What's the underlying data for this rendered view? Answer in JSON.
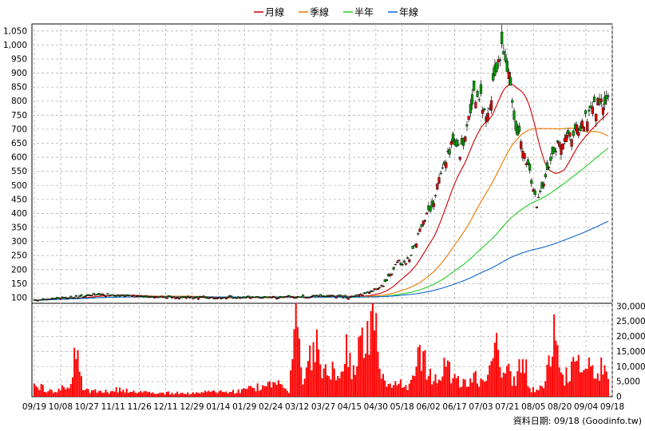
{
  "chart_data": {
    "type": "candlestick",
    "legend": [
      {
        "name": "月線",
        "color": "#cc0000"
      },
      {
        "name": "季線",
        "color": "#ee7700"
      },
      {
        "name": "半年",
        "color": "#22cc22"
      },
      {
        "name": "年線",
        "color": "#1166cc"
      }
    ],
    "price_axis": {
      "ticks": [
        "1,050",
        "1,000",
        "950",
        "900",
        "850",
        "800",
        "750",
        "700",
        "650",
        "600",
        "550",
        "500",
        "450",
        "400",
        "350",
        "300",
        "250",
        "200",
        "150",
        "100"
      ],
      "range": [
        80,
        1075
      ]
    },
    "volume_axis": {
      "ticks": [
        "30,000",
        "25,000",
        "20,000",
        "15,000",
        "10,000",
        "5,000",
        "0"
      ],
      "range": [
        0,
        31000
      ]
    },
    "x_ticks": [
      "09/19",
      "10/08",
      "10/27",
      "11/11",
      "11/26",
      "12/11",
      "12/29",
      "01/14",
      "01/29",
      "02/24",
      "03/12",
      "03/27",
      "04/15",
      "04/30",
      "05/18",
      "06/02",
      "06/17",
      "07/03",
      "07/21",
      "08/05",
      "08/20",
      "09/04",
      "09/18"
    ],
    "close_trend": [
      [
        0,
        90
      ],
      [
        20,
        100
      ],
      [
        40,
        112
      ],
      [
        60,
        105
      ],
      [
        80,
        102
      ],
      [
        100,
        100
      ],
      [
        120,
        100
      ],
      [
        140,
        102
      ],
      [
        160,
        103
      ],
      [
        170,
        108
      ],
      [
        180,
        100
      ],
      [
        190,
        115
      ],
      [
        200,
        145
      ],
      [
        205,
        190
      ],
      [
        208,
        230
      ],
      [
        212,
        220
      ],
      [
        216,
        250
      ],
      [
        220,
        320
      ],
      [
        224,
        380
      ],
      [
        228,
        420
      ],
      [
        232,
        520
      ],
      [
        236,
        600
      ],
      [
        240,
        660
      ],
      [
        244,
        620
      ],
      [
        248,
        700
      ],
      [
        252,
        820
      ],
      [
        256,
        800
      ],
      [
        260,
        760
      ],
      [
        264,
        900
      ],
      [
        268,
        1000
      ],
      [
        272,
        880
      ],
      [
        276,
        720
      ],
      [
        280,
        620
      ],
      [
        284,
        550
      ],
      [
        288,
        430
      ],
      [
        292,
        520
      ],
      [
        296,
        600
      ],
      [
        300,
        640
      ],
      [
        304,
        650
      ],
      [
        308,
        680
      ],
      [
        312,
        700
      ],
      [
        316,
        730
      ],
      [
        320,
        770
      ],
      [
        324,
        790
      ],
      [
        328,
        800
      ]
    ],
    "volume_profile": [
      [
        0,
        4000
      ],
      [
        4,
        3000
      ],
      [
        8,
        2000
      ],
      [
        12,
        2000
      ],
      [
        16,
        3000
      ],
      [
        20,
        2500
      ],
      [
        24,
        15000
      ],
      [
        28,
        3000
      ],
      [
        32,
        2000
      ],
      [
        40,
        1500
      ],
      [
        48,
        2500
      ],
      [
        56,
        1500
      ],
      [
        64,
        1500
      ],
      [
        72,
        1200
      ],
      [
        80,
        1200
      ],
      [
        88,
        1200
      ],
      [
        96,
        1500
      ],
      [
        104,
        1500
      ],
      [
        112,
        1500
      ],
      [
        120,
        2000
      ],
      [
        130,
        3500
      ],
      [
        140,
        4000
      ],
      [
        146,
        1500
      ],
      [
        150,
        28000
      ],
      [
        154,
        6000
      ],
      [
        158,
        12000
      ],
      [
        162,
        20000
      ],
      [
        166,
        8000
      ],
      [
        170,
        10000
      ],
      [
        174,
        5000
      ],
      [
        178,
        18000
      ],
      [
        182,
        8000
      ],
      [
        186,
        14000
      ],
      [
        190,
        20000
      ],
      [
        194,
        30000
      ],
      [
        198,
        12000
      ],
      [
        202,
        2500
      ],
      [
        208,
        6000
      ],
      [
        214,
        3000
      ],
      [
        222,
        15000
      ],
      [
        228,
        5000
      ],
      [
        236,
        10000
      ],
      [
        244,
        4000
      ],
      [
        252,
        6000
      ],
      [
        260,
        6000
      ],
      [
        264,
        20000
      ],
      [
        268,
        6000
      ],
      [
        272,
        8000
      ],
      [
        276,
        4000
      ],
      [
        280,
        15000
      ],
      [
        284,
        2500
      ],
      [
        292,
        3000
      ],
      [
        298,
        24000
      ],
      [
        302,
        6000
      ],
      [
        306,
        7000
      ],
      [
        310,
        12000
      ],
      [
        314,
        8000
      ],
      [
        318,
        12000
      ],
      [
        322,
        6000
      ],
      [
        326,
        13000
      ],
      [
        328,
        10000
      ]
    ]
  },
  "source_label": "資料日期: 09/18 (Goodinfo.tw)"
}
